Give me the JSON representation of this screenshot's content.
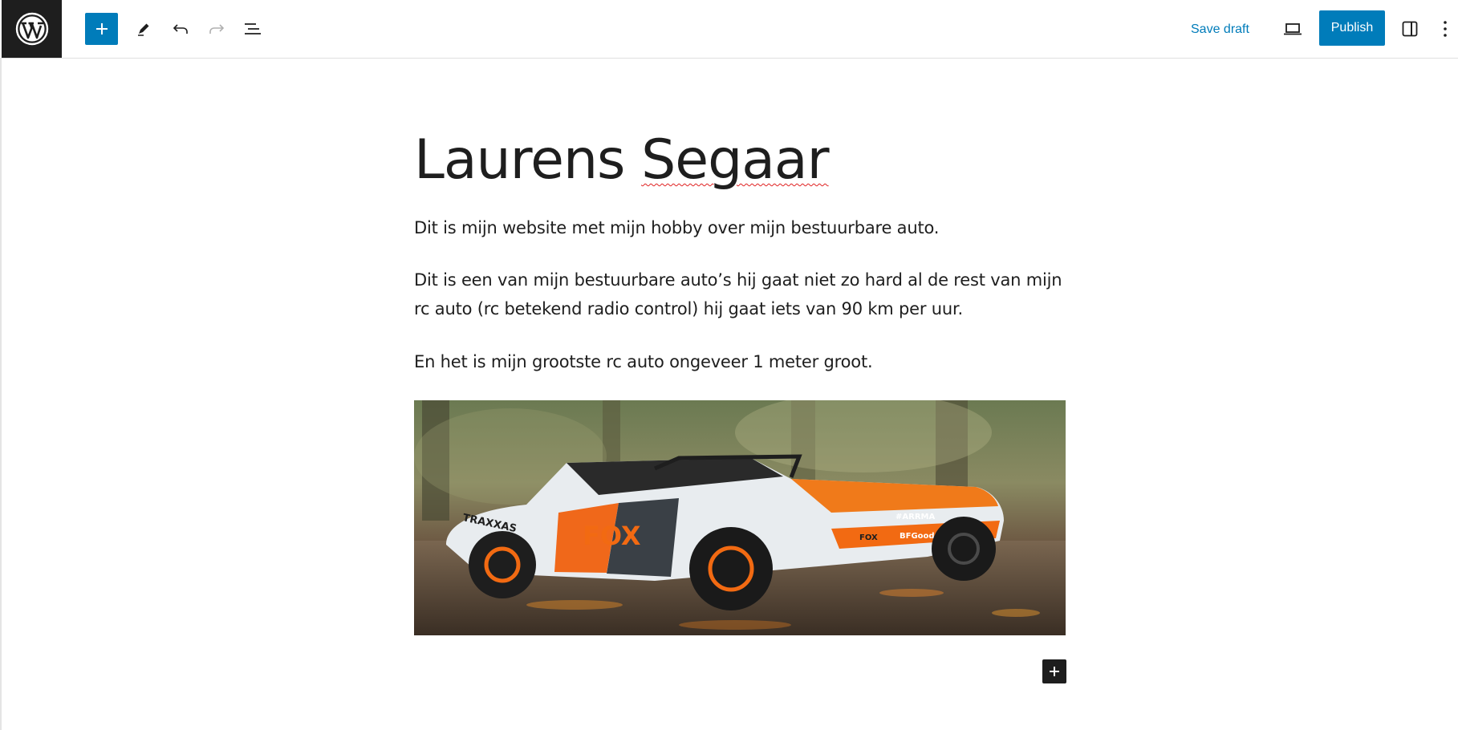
{
  "toolbar": {
    "logo_icon": "wordpress-icon",
    "add_block_icon": "plus-icon",
    "tools_icon": "pencil-icon",
    "undo_icon": "undo-icon",
    "redo_icon": "redo-icon",
    "list_view_icon": "list-view-icon",
    "save_draft_label": "Save draft",
    "preview_icon": "desktop-preview-icon",
    "publish_label": "Publish",
    "settings_icon": "sidebar-settings-icon",
    "options_icon": "more-vertical-icon"
  },
  "post": {
    "title_first": "Laurens ",
    "title_second": "Segaar",
    "paragraphs": [
      "Dit is mijn website met mijn hobby over mijn bestuurbare auto.",
      "Dit is een van mijn bestuurbare auto’s hij gaat niet zo hard al de rest van mijn rc auto (rc betekend radio control) hij gaat iets van 90 km per uur.",
      "En het is mijn grootste rc auto ongeveer 1 meter groot."
    ],
    "image_subject": "rc-truck-photo",
    "image_texts": {
      "side_brand": "FOX",
      "side_logo": "TRAXXAS",
      "hood_logo": "#ARRMA",
      "bumper_logo": "BFGoodrich",
      "fender_logo": "FOX"
    }
  },
  "colors": {
    "accent": "#007cba",
    "dark": "#1e1e1e",
    "spellcheck": "#e02020"
  }
}
